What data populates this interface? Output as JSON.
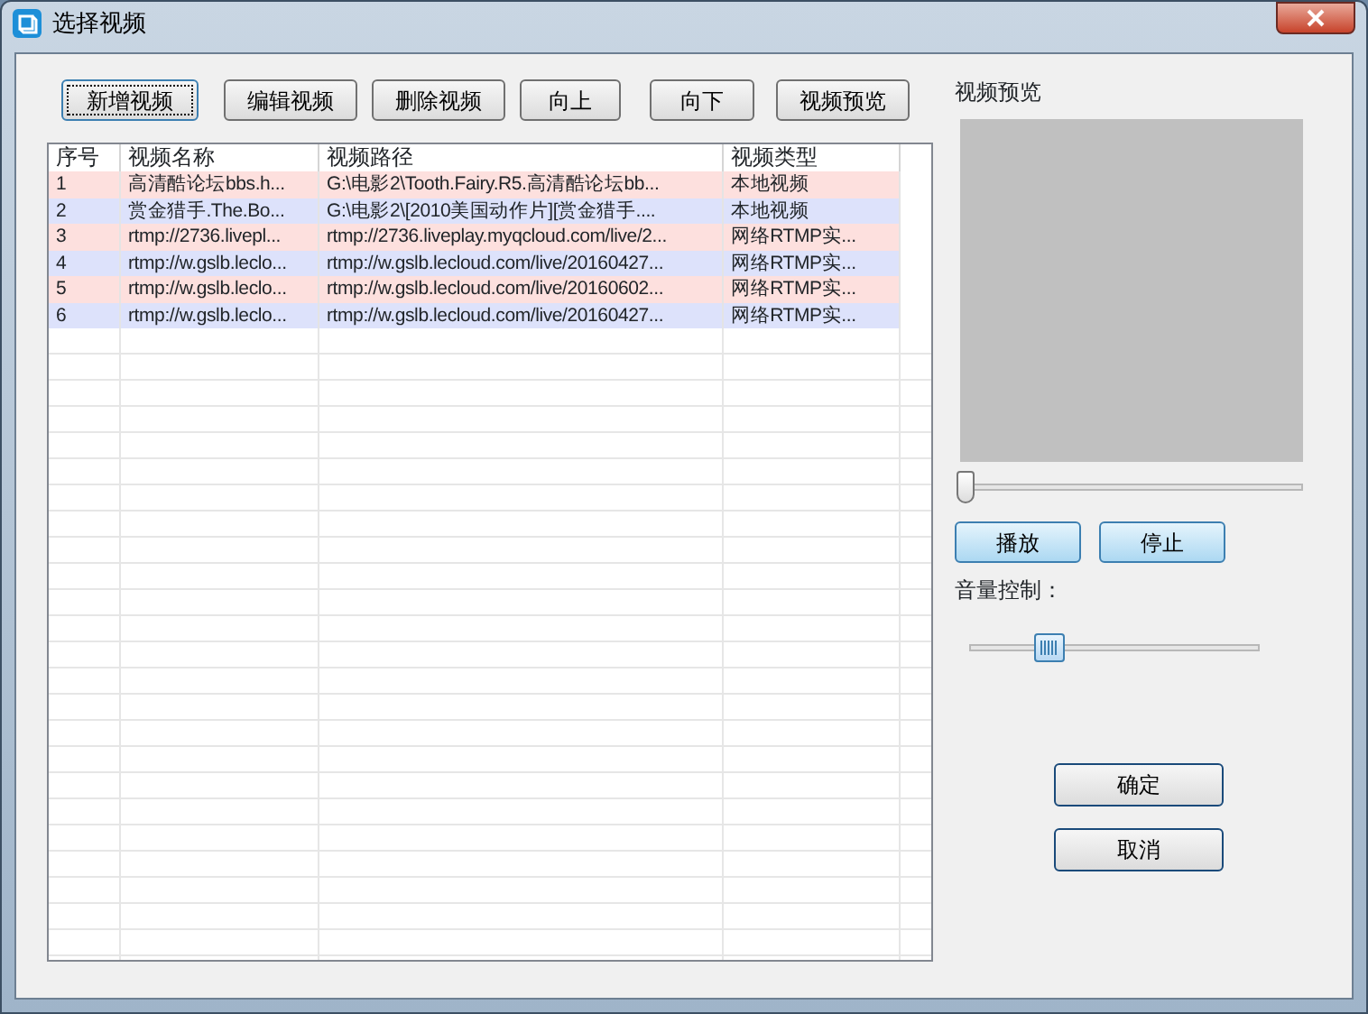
{
  "window": {
    "title": "选择视频"
  },
  "toolbar": [
    {
      "label": "新增视频",
      "focused": true
    },
    {
      "label": "编辑视频",
      "focused": false
    },
    {
      "label": "删除视频",
      "focused": false
    },
    {
      "label": "向上",
      "focused": false
    },
    {
      "label": "向下",
      "focused": false
    },
    {
      "label": "视频预览",
      "focused": false
    }
  ],
  "table": {
    "columns": [
      "序号",
      "视频名称",
      "视频路径",
      "视频类型"
    ],
    "rows": [
      [
        "1",
        "高清酷论坛bbs.h...",
        "G:\\电影2\\Tooth.Fairy.R5.高清酷论坛bb...",
        "本地视频"
      ],
      [
        "2",
        "赏金猎手.The.Bo...",
        "G:\\电影2\\[2010美国动作片][赏金猎手....",
        "本地视频"
      ],
      [
        "3",
        "rtmp://2736.livepl...",
        "rtmp://2736.liveplay.myqcloud.com/live/2...",
        "网络RTMP实..."
      ],
      [
        "4",
        "rtmp://w.gslb.leclo...",
        "rtmp://w.gslb.lecloud.com/live/20160427...",
        "网络RTMP实..."
      ],
      [
        "5",
        "rtmp://w.gslb.leclo...",
        "rtmp://w.gslb.lecloud.com/live/20160602...",
        "网络RTMP实..."
      ],
      [
        "6",
        "rtmp://w.gslb.leclo...",
        "rtmp://w.gslb.lecloud.com/live/20160427...",
        "网络RTMP实..."
      ]
    ]
  },
  "preview": {
    "label": "视频预览",
    "position": {
      "level": 0
    },
    "buttons": [
      "播放",
      "停止"
    ]
  },
  "volume": {
    "label": "音量控制：",
    "level": 0.25
  },
  "dialog_buttons": [
    "确定",
    "取消"
  ]
}
